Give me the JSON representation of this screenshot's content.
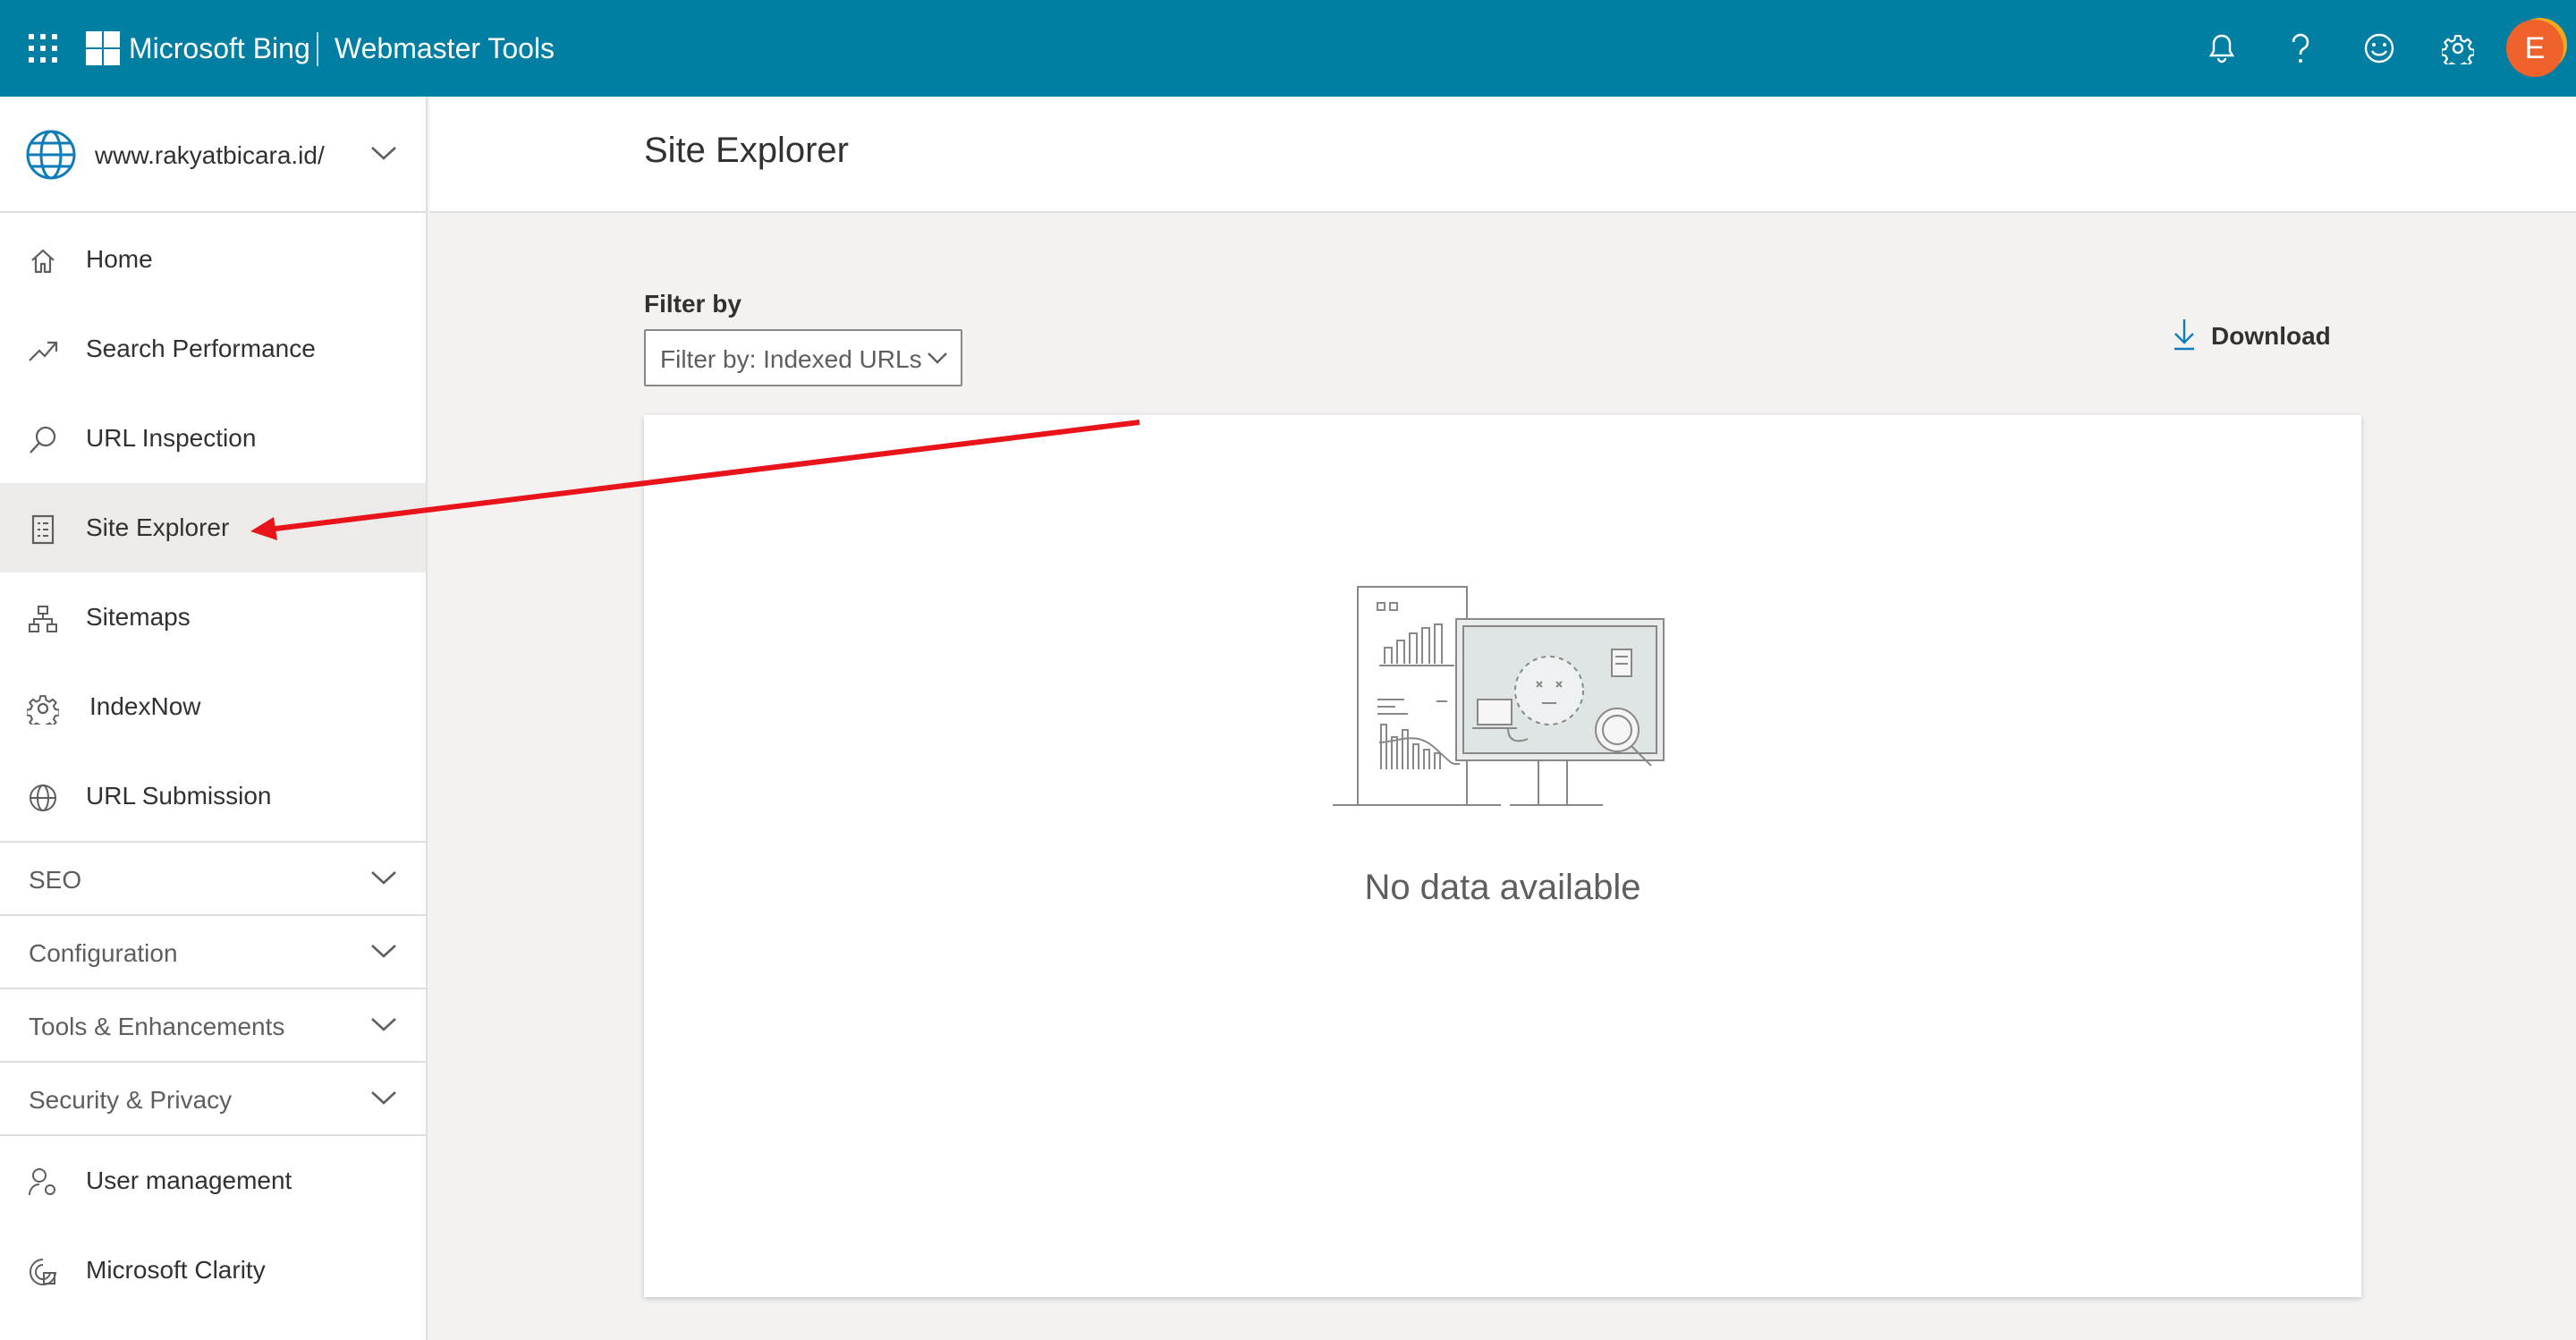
{
  "header": {
    "brand": "Microsoft Bing",
    "product": "Webmaster Tools",
    "avatar_initial": "E",
    "icons": [
      "app-launcher-icon",
      "bell-icon",
      "help-icon",
      "feedback-smiley-icon",
      "gear-icon"
    ]
  },
  "site": {
    "url": "www.rakyatbicara.id/"
  },
  "sidebar": {
    "items": [
      {
        "label": "Home",
        "icon": "home-icon"
      },
      {
        "label": "Search Performance",
        "icon": "trend-icon"
      },
      {
        "label": "URL Inspection",
        "icon": "magnifier-icon"
      },
      {
        "label": "Site Explorer",
        "icon": "document-list-icon",
        "active": true
      },
      {
        "label": "Sitemaps",
        "icon": "sitemap-icon"
      },
      {
        "label": "IndexNow",
        "icon": "gear-cog-icon"
      },
      {
        "label": "URL Submission",
        "icon": "globe-icon"
      }
    ],
    "groups": [
      {
        "label": "SEO"
      },
      {
        "label": "Configuration"
      },
      {
        "label": "Tools & Enhancements"
      },
      {
        "label": "Security & Privacy"
      }
    ],
    "bottom_items": [
      {
        "label": "User management",
        "icon": "user-gear-icon"
      },
      {
        "label": "Microsoft Clarity",
        "icon": "clarity-icon"
      }
    ]
  },
  "main": {
    "title": "Site Explorer",
    "filter": {
      "label": "Filter by",
      "value": "Filter by: Indexed URLs"
    },
    "download_label": "Download",
    "empty_message": "No data available"
  },
  "colors": {
    "topbar": "#017fa3",
    "avatar": "#f0622b",
    "annotation_arrow": "#e8141a"
  }
}
